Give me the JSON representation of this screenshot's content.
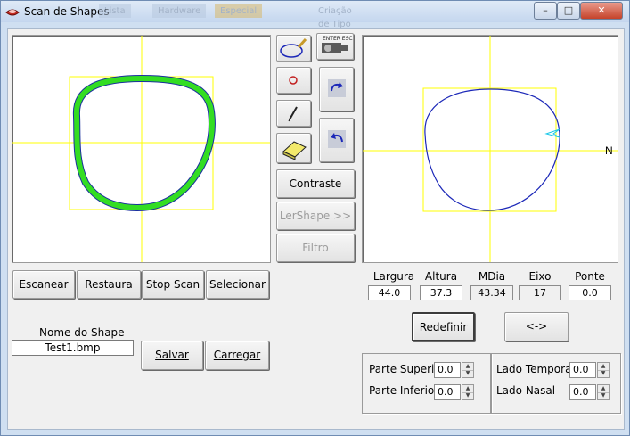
{
  "window": {
    "title": "Scan de Shapes"
  },
  "background_tabs": [
    "Lista",
    "Hardware",
    "Especial",
    "Criação de Tipo"
  ],
  "left_buttons": {
    "scan": "Escanear",
    "restore": "Restaura",
    "stop": "Stop Scan",
    "select": "Selecionar"
  },
  "tools": {
    "camera_caption": "ENTER ESC",
    "contrast": "Contraste",
    "read_shape": "LerShape >>",
    "filter": "Filtro"
  },
  "measurements": {
    "headers": [
      "Largura",
      "Altura",
      "MDia",
      "Eixo",
      "Ponte"
    ],
    "values": [
      "44.0",
      "37.3",
      "43.34",
      "17",
      "0.0"
    ]
  },
  "right_preview": {
    "nasal_marker": "N"
  },
  "actions": {
    "redefine": "Redefinir",
    "swap": "<->"
  },
  "shape_name": {
    "label": "Nome do Shape",
    "value": "Test1.bmp"
  },
  "file_buttons": {
    "save": "Salvar",
    "load": "Carregar"
  },
  "adjustments": {
    "top_label": "Parte Superior",
    "top_value": "0.0",
    "bottom_label": "Parte Inferior",
    "bottom_value": "0.0",
    "temporal_label": "Lado Temporal",
    "temporal_value": "0.0",
    "nasal_label": "Lado Nasal",
    "nasal_value": "0.0"
  },
  "colors": {
    "shape_fill": "#33dd22",
    "shape_outline": "#1a2f9e",
    "guide": "#ffff00",
    "preview_line": "#1c28b8"
  }
}
